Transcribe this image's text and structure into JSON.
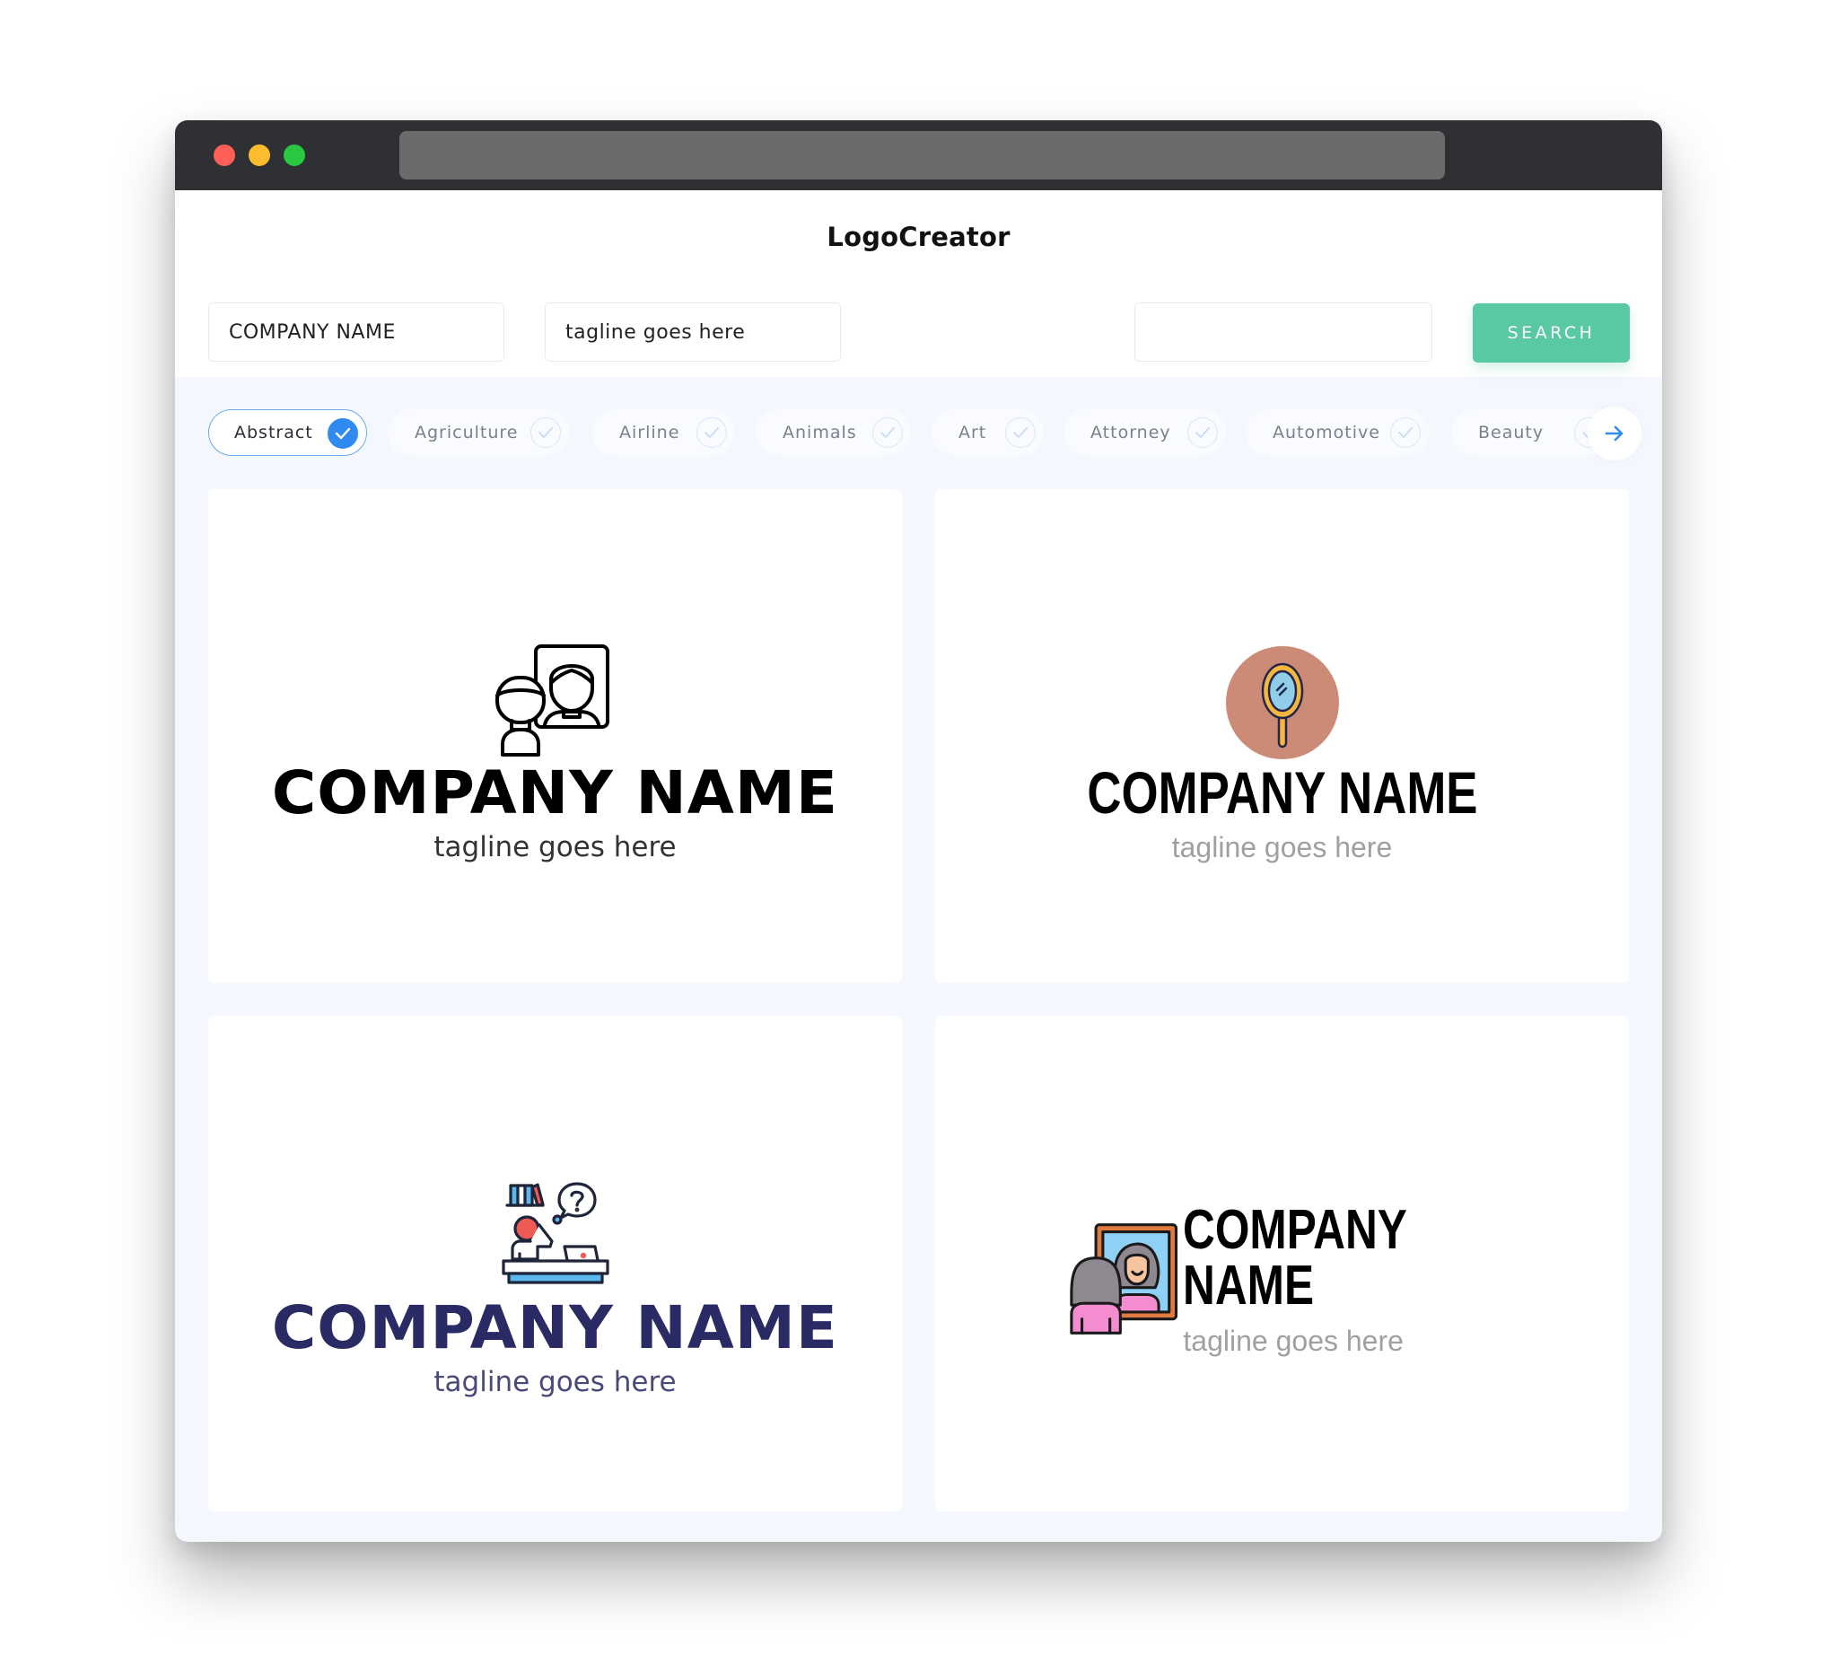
{
  "window": {
    "title_dots": [
      "close",
      "minimize",
      "maximize"
    ],
    "url": ""
  },
  "header": {
    "title": "LogoCreator"
  },
  "search": {
    "company_name_value": "COMPANY NAME",
    "tagline_value": "tagline goes here",
    "keyword_value": "",
    "search_button_label": "SEARCH"
  },
  "categories": {
    "items": [
      {
        "label": "Abstract",
        "selected": true
      },
      {
        "label": "Agriculture",
        "selected": false
      },
      {
        "label": "Airline",
        "selected": false
      },
      {
        "label": "Animals",
        "selected": false
      },
      {
        "label": "Art",
        "selected": false
      },
      {
        "label": "Attorney",
        "selected": false
      },
      {
        "label": "Automotive",
        "selected": false
      },
      {
        "label": "Beauty",
        "selected": false
      }
    ],
    "next_icon": "arrow-right-icon"
  },
  "colors": {
    "accent_green": "#58c9a0",
    "accent_blue": "#2f8bf0",
    "navy": "#2a2a64",
    "mirror_circle": "#cc8b76"
  },
  "logos": [
    {
      "icon": "people-portrait-icon",
      "company_name": "COMPANY NAME",
      "tagline": "tagline goes here",
      "name_color": "#000000",
      "tagline_color": "#333333"
    },
    {
      "icon": "hand-mirror-icon",
      "company_name": "COMPANY NAME",
      "tagline": "tagline goes here",
      "name_color": "#000000",
      "tagline_color": "#a0a0a0"
    },
    {
      "icon": "student-desk-question-icon",
      "company_name": "COMPANY NAME",
      "tagline": "tagline goes here",
      "name_color": "#2a2a64",
      "tagline_color": "#4a4a7a"
    },
    {
      "icon": "woman-mirror-icon",
      "company_name": "COMPANY NAME",
      "tagline": "tagline goes here",
      "name_color": "#000000",
      "tagline_color": "#a0a0a0"
    }
  ]
}
